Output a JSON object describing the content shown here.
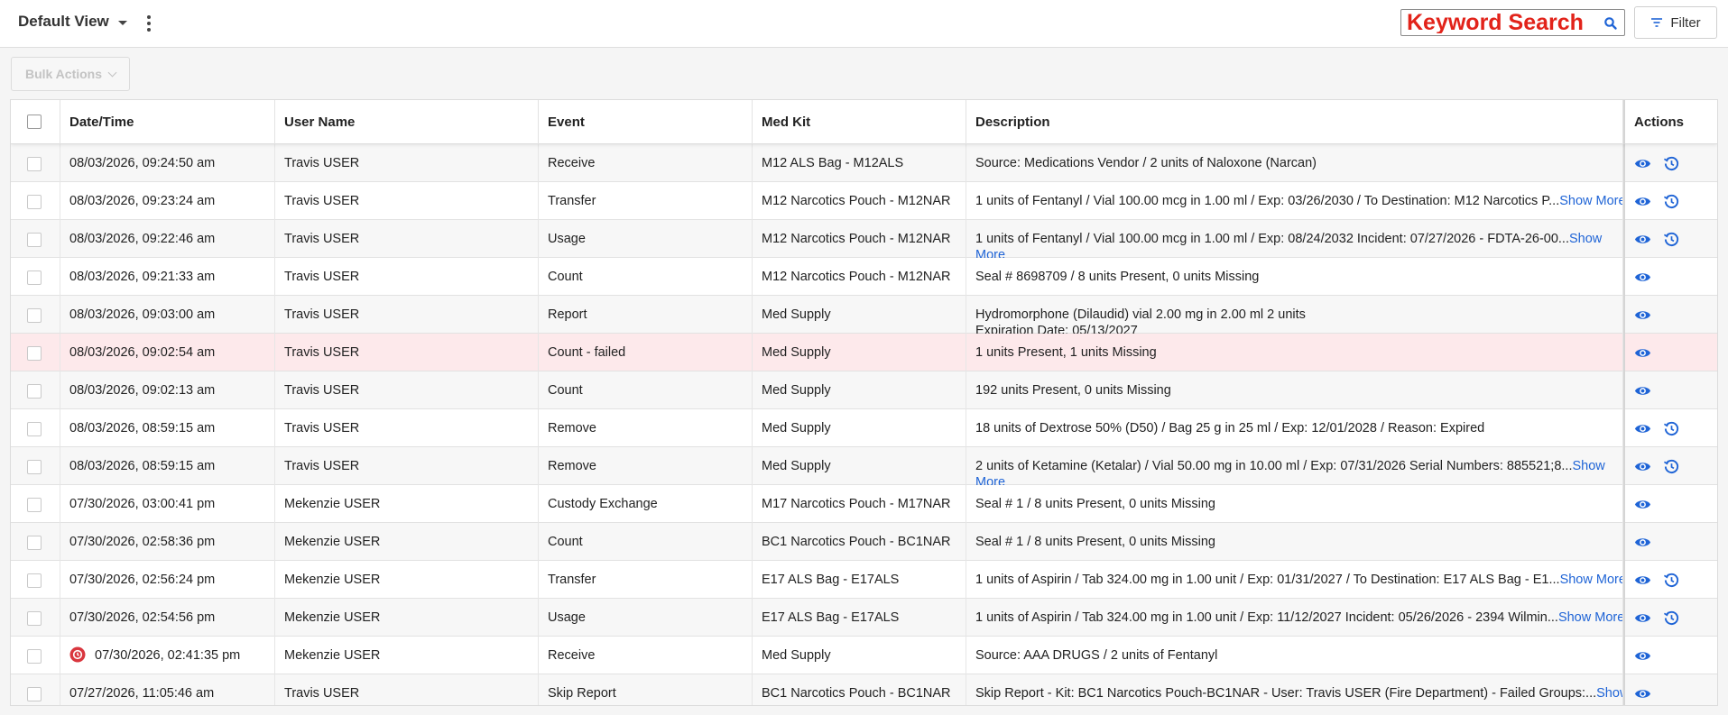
{
  "toolbar": {
    "view_label": "Default View",
    "search_placeholder": "Keyword Search",
    "filter_label": "Filter",
    "bulk_actions_label": "Bulk Actions"
  },
  "colors": {
    "accent": "#1f64d6",
    "search_text": "#e2231a",
    "failed_row": "#fde9eb",
    "alert_badge": "#d9363e"
  },
  "icons": {
    "view": "eye-icon",
    "history": "history-icon",
    "search": "search-icon",
    "filter": "filter-icon",
    "more": "kebab-menu-icon",
    "alert": "alert-badge-icon"
  },
  "table": {
    "columns": [
      "Date/Time",
      "User Name",
      "Event",
      "Med Kit",
      "Description",
      "Actions"
    ],
    "rows": [
      {
        "datetime": "08/03/2026, 09:24:50 am",
        "user": "Travis USER",
        "event": "Receive",
        "medkit": "M12 ALS Bag - M12ALS",
        "description": "Source: Medications Vendor / 2 units of Naloxone (Narcan)",
        "show_more": "",
        "history": true,
        "failed": false,
        "alert": false
      },
      {
        "datetime": "08/03/2026, 09:23:24 am",
        "user": "Travis USER",
        "event": "Transfer",
        "medkit": "M12 Narcotics Pouch - M12NAR",
        "description": "1 units of Fentanyl / Vial 100.00 mcg in 1.00 ml / Exp: 03/26/2030 / To Destination: M12 Narcotics P...",
        "show_more": "Show More",
        "history": true,
        "failed": false,
        "alert": false
      },
      {
        "datetime": "08/03/2026, 09:22:46 am",
        "user": "Travis USER",
        "event": "Usage",
        "medkit": "M12 Narcotics Pouch - M12NAR",
        "description": "1 units of Fentanyl / Vial 100.00 mcg in 1.00 ml / Exp: 08/24/2032 Incident: 07/27/2026 - FDTA-26-00...",
        "show_more": "Show More",
        "history": true,
        "failed": false,
        "alert": false,
        "tall": true
      },
      {
        "datetime": "08/03/2026, 09:21:33 am",
        "user": "Travis USER",
        "event": "Count",
        "medkit": "M12 Narcotics Pouch - M12NAR",
        "description": "Seal # 8698709 / 8 units Present, 0 units Missing",
        "show_more": "",
        "history": false,
        "failed": false,
        "alert": false
      },
      {
        "datetime": "08/03/2026, 09:03:00 am",
        "user": "Travis USER",
        "event": "Report",
        "medkit": "Med Supply",
        "description": "Hydromorphone (Dilaudid) vial 2.00 mg in 2.00 ml 2 units",
        "description_line2": "Expiration Date: 05/13/2027",
        "show_more": "",
        "history": false,
        "failed": false,
        "alert": false,
        "tall": true
      },
      {
        "datetime": "08/03/2026, 09:02:54 am",
        "user": "Travis USER",
        "event": "Count - failed",
        "medkit": "Med Supply",
        "description": "1 units Present, 1 units Missing",
        "show_more": "",
        "history": false,
        "failed": true,
        "alert": false
      },
      {
        "datetime": "08/03/2026, 09:02:13 am",
        "user": "Travis USER",
        "event": "Count",
        "medkit": "Med Supply",
        "description": "192 units Present, 0 units Missing",
        "show_more": "",
        "history": false,
        "failed": false,
        "alert": false
      },
      {
        "datetime": "08/03/2026, 08:59:15 am",
        "user": "Travis USER",
        "event": "Remove",
        "medkit": "Med Supply",
        "description": "18 units of Dextrose 50% (D50) / Bag 25 g in 25 ml / Exp: 12/01/2028 / Reason: Expired",
        "show_more": "",
        "history": true,
        "failed": false,
        "alert": false
      },
      {
        "datetime": "08/03/2026, 08:59:15 am",
        "user": "Travis USER",
        "event": "Remove",
        "medkit": "Med Supply",
        "description": "2 units of Ketamine (Ketalar) / Vial 50.00 mg in 10.00 ml / Exp: 07/31/2026 Serial Numbers: 885521;8...",
        "show_more": "Show More",
        "history": true,
        "failed": false,
        "alert": false,
        "tall": true
      },
      {
        "datetime": "07/30/2026, 03:00:41 pm",
        "user": "Mekenzie USER",
        "event": "Custody Exchange",
        "medkit": "M17 Narcotics Pouch - M17NAR",
        "description": "Seal # 1 / 8 units Present, 0 units Missing",
        "show_more": "",
        "history": false,
        "failed": false,
        "alert": false
      },
      {
        "datetime": "07/30/2026, 02:58:36 pm",
        "user": "Mekenzie USER",
        "event": "Count",
        "medkit": "BC1 Narcotics Pouch - BC1NAR",
        "description": "Seal # 1 / 8 units Present, 0 units Missing",
        "show_more": "",
        "history": false,
        "failed": false,
        "alert": false
      },
      {
        "datetime": "07/30/2026, 02:56:24 pm",
        "user": "Mekenzie USER",
        "event": "Transfer",
        "medkit": "E17 ALS Bag - E17ALS",
        "description": "1 units of Aspirin / Tab 324.00 mg in 1.00 unit / Exp: 01/31/2027 / To Destination: E17 ALS Bag - E1...",
        "show_more": "Show More",
        "history": true,
        "failed": false,
        "alert": false
      },
      {
        "datetime": "07/30/2026, 02:54:56 pm",
        "user": "Mekenzie USER",
        "event": "Usage",
        "medkit": "E17 ALS Bag - E17ALS",
        "description": "1 units of Aspirin / Tab 324.00 mg in 1.00 unit / Exp: 11/12/2027 Incident: 05/26/2026 - 2394 Wilmin...",
        "show_more": "Show More",
        "history": true,
        "failed": false,
        "alert": false
      },
      {
        "datetime": "07/30/2026, 02:41:35 pm",
        "user": "Mekenzie USER",
        "event": "Receive",
        "medkit": "Med Supply",
        "description": "Source: AAA DRUGS / 2 units of Fentanyl",
        "show_more": "",
        "history": false,
        "failed": false,
        "alert": true
      },
      {
        "datetime": "07/27/2026, 11:05:46 am",
        "user": "Travis USER",
        "event": "Skip Report",
        "medkit": "BC1 Narcotics Pouch - BC1NAR",
        "description": "Skip Report - Kit: BC1 Narcotics Pouch-BC1NAR - User: Travis USER (Fire Department) - Failed Groups:...",
        "show_more": "Show",
        "history": false,
        "failed": false,
        "alert": false
      }
    ]
  }
}
